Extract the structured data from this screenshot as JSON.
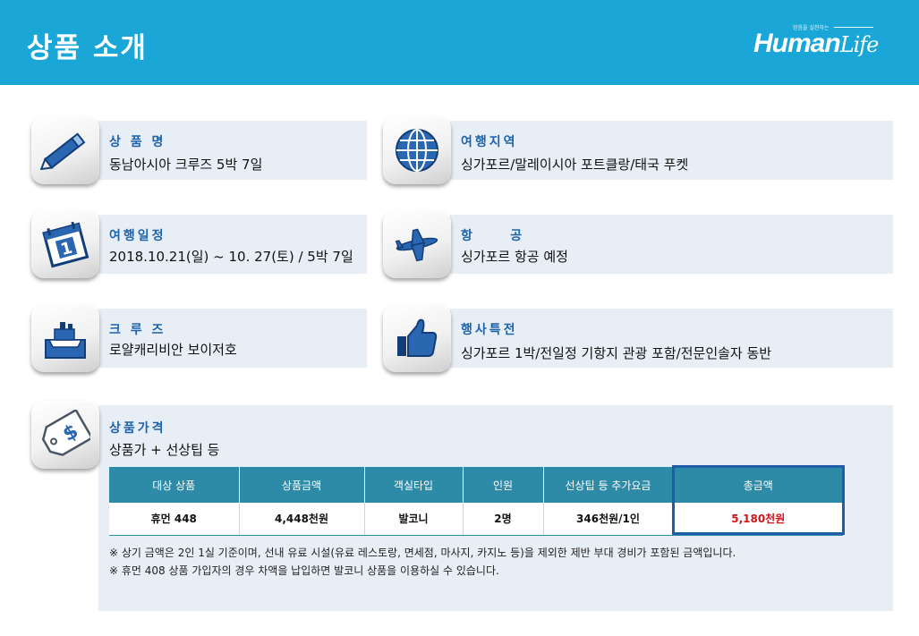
{
  "page_title": "상품 소개",
  "logo": {
    "tagline": "믿음을 실천하는",
    "brand_main": "Human",
    "brand_script": "Life"
  },
  "items": [
    {
      "icon": "pencil-icon",
      "label": "상 품 명",
      "value": "동남아시아 크루즈 5박 7일"
    },
    {
      "icon": "globe-icon",
      "label": "여행지역",
      "value": "싱가포르/말레이시아 포트클랑/태국 푸켓"
    },
    {
      "icon": "calendar-icon",
      "label": "여행일정",
      "value": "2018.10.21(일) ~ 10. 27(토) / 5박 7일"
    },
    {
      "icon": "airplane-icon",
      "label": "항     공",
      "value": "싱가포르 항공 예정"
    },
    {
      "icon": "cruise-ship-icon",
      "label": "크 루 즈",
      "value": "로얄캐리비안 보이저호"
    },
    {
      "icon": "thumbs-up-icon",
      "label": "행사특전",
      "value": "싱가포르 1박/전일정 기항지 관광 포함/전문인솔자 동반"
    }
  ],
  "price": {
    "icon": "price-tag-icon",
    "label": "상품가격",
    "value": "상품가 + 선상팁 등",
    "table": {
      "headers": [
        "대상 상품",
        "상품금액",
        "객실타입",
        "인원",
        "선상팁 등 추가요금",
        "총금액"
      ],
      "row": [
        "휴먼 448",
        "4,448천원",
        "발코니",
        "2명",
        "346천원/1인",
        "5,180천원"
      ]
    },
    "notes": [
      "※ 상기 금액은 2인 1실 기준이며, 선내 유료 시설(유료 레스토랑, 면세점, 마사지, 카지노 등)을 제외한 제반 부대 경비가 포함된 금액입니다.",
      "※ 휴먼 408 상품 가입자의 경우 차액을 납입하면 발코니 상품을 이용하실 수 있습니다."
    ]
  },
  "colors": {
    "header": "#1aa7d8",
    "card_bg": "#e8eef6",
    "label": "#1d63a9",
    "table_header": "#2e8ba8",
    "total_text": "#d0141b",
    "total_frame": "#1f5da8"
  }
}
